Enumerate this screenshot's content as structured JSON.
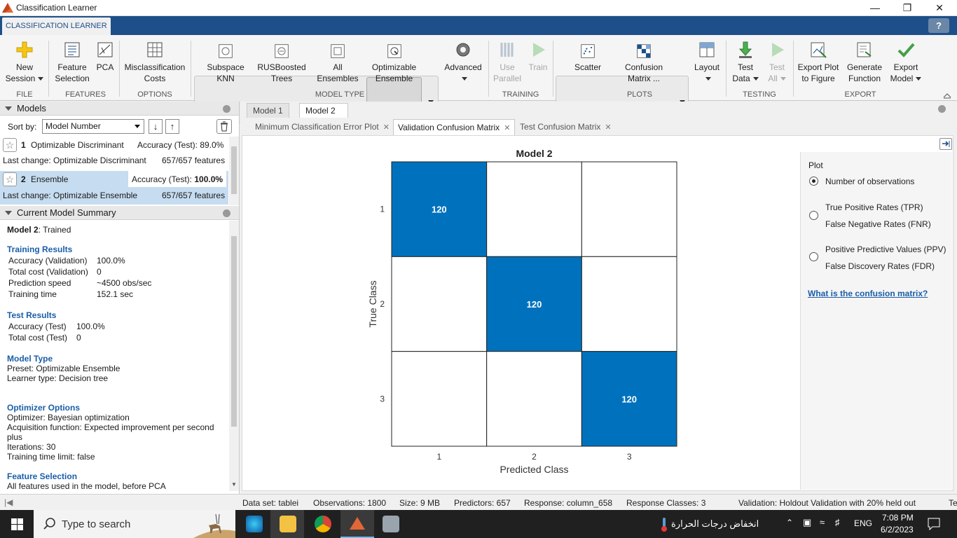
{
  "window": {
    "title": "Classification Learner"
  },
  "ribbon": {
    "tab": "CLASSIFICATION LEARNER",
    "help": "?",
    "buttons": {
      "new_session": [
        "New",
        "Session"
      ],
      "feature_selection": [
        "Feature",
        "Selection"
      ],
      "pca": "PCA",
      "misclassification": [
        "Misclassification",
        "Costs"
      ],
      "subspace_knn": [
        "Subspace",
        "KNN"
      ],
      "rusboosted": [
        "RUSBoosted",
        "Trees"
      ],
      "all_ensembles": [
        "All",
        "Ensembles"
      ],
      "optimizable_ensemble": [
        "Optimizable",
        "Ensemble"
      ],
      "advanced": "Advanced",
      "use_parallel": [
        "Use",
        "Parallel"
      ],
      "train": "Train",
      "scatter": "Scatter",
      "confusion_matrix": [
        "Confusion",
        "Matrix"
      ],
      "confusion_more": "...",
      "layout": "Layout",
      "test_data": [
        "Test",
        "Data"
      ],
      "test_all": [
        "Test",
        "All"
      ],
      "export_plot": [
        "Export Plot",
        "to Figure"
      ],
      "generate_function": [
        "Generate",
        "Function"
      ],
      "export_model": [
        "Export",
        "Model"
      ]
    },
    "groups": {
      "file": "FILE",
      "features": "FEATURES",
      "options": "OPTIONS",
      "model_type": "MODEL TYPE",
      "training": "TRAINING",
      "plots": "PLOTS",
      "testing": "TESTING",
      "export": "EXPORT"
    }
  },
  "models_panel": {
    "title": "Models",
    "sort_by_label": "Sort by:",
    "sort_value": "Model Number",
    "models": [
      {
        "num": "1",
        "name": "Optimizable Discriminant",
        "accuracy": "Accuracy (Test): 89.0%",
        "last_change": "Last change: Optimizable Discriminant",
        "features": "657/657 features"
      },
      {
        "num": "2",
        "name": "Ensemble",
        "accuracy_label": "Accuracy (Test): ",
        "accuracy_value": "100.0%",
        "last_change": "Last change: Optimizable Ensemble",
        "features": "657/657 features"
      }
    ]
  },
  "summary": {
    "title": "Current Model Summary",
    "model_name": "Model 2",
    "model_state": ": Trained",
    "training_results_hdr": "Training Results",
    "training_results": [
      {
        "label": "Accuracy (Validation)",
        "value": "100.0%"
      },
      {
        "label": "Total cost (Validation)",
        "value": "0"
      },
      {
        "label": "Prediction speed",
        "value": "~4500 obs/sec"
      },
      {
        "label": "Training time",
        "value": "152.1 sec"
      }
    ],
    "test_results_hdr": "Test Results",
    "test_results": [
      {
        "label": "Accuracy (Test)",
        "value": "100.0%"
      },
      {
        "label": "Total cost (Test)",
        "value": "0"
      }
    ],
    "model_type_hdr": "Model Type",
    "model_type": [
      "Preset: Optimizable Ensemble",
      "Learner type: Decision tree"
    ],
    "optimizer_hdr": "Optimizer Options",
    "optimizer": [
      "Optimizer: Bayesian optimization",
      "Acquisition function: Expected improvement per second",
      "plus",
      "Iterations: 30",
      "Training time limit: false"
    ],
    "feature_sel_hdr": "Feature Selection",
    "feature_sel": "All features used in the model, before PCA"
  },
  "doc_tabs": [
    "Model 1",
    "Model 2"
  ],
  "plot_tabs": [
    "Minimum Classification Error Plot",
    "Validation Confusion Matrix",
    "Test Confusion Matrix"
  ],
  "chart_data": {
    "type": "heatmap",
    "title": "Model 2",
    "xlabel": "Predicted Class",
    "ylabel": "True Class",
    "x_ticks": [
      "1",
      "2",
      "3"
    ],
    "y_ticks": [
      "1",
      "2",
      "3"
    ],
    "matrix": [
      [
        120,
        0,
        0
      ],
      [
        0,
        120,
        0
      ],
      [
        0,
        0,
        120
      ]
    ],
    "diag_color": "#0072bd"
  },
  "plot_options": {
    "title": "Plot",
    "options": [
      {
        "lines": [
          "Number of observations"
        ],
        "selected": true
      },
      {
        "lines": [
          "True Positive Rates (TPR)",
          "False Negative Rates (FNR)"
        ],
        "selected": false
      },
      {
        "lines": [
          "Positive Predictive Values (PPV)",
          "False Discovery Rates (FDR)"
        ],
        "selected": false
      }
    ],
    "link": "What is the confusion matrix?"
  },
  "status": {
    "dataset": "Data set: tablei",
    "observations": "Observations: 1800",
    "size": "Size: 9 MB",
    "predictors": "Predictors: 657",
    "response": "Response: column_658",
    "classes": "Response Classes: 3",
    "validation": "Validation: Holdout Validation with 20% held out",
    "trunc": "Te"
  },
  "taskbar": {
    "search_placeholder": "Type to search",
    "weather": "انخفاض درجات الحرارة",
    "lang": "ENG",
    "time": "7:08 PM",
    "date": "6/2/2023"
  }
}
